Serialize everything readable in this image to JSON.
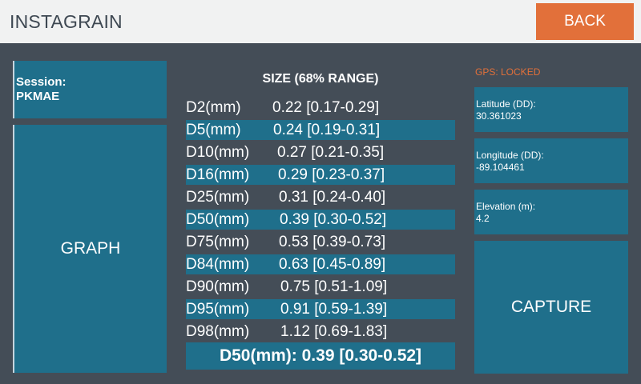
{
  "header": {
    "title": "INSTAGRAIN",
    "back_label": "BACK"
  },
  "session": {
    "label": "Session:",
    "value": "PKMAE"
  },
  "graph_label": "GRAPH",
  "size_table": {
    "title": "SIZE (68% RANGE)",
    "rows": [
      {
        "label": "D2(mm)",
        "value": "0.22 [0.17-0.29]"
      },
      {
        "label": "D5(mm)",
        "value": "0.24 [0.19-0.31]"
      },
      {
        "label": "D10(mm)",
        "value": "0.27 [0.21-0.35]"
      },
      {
        "label": "D16(mm)",
        "value": "0.29 [0.23-0.37]"
      },
      {
        "label": "D25(mm)",
        "value": "0.31 [0.24-0.40]"
      },
      {
        "label": "D50(mm)",
        "value": "0.39 [0.30-0.52]"
      },
      {
        "label": "D75(mm)",
        "value": "0.53 [0.39-0.73]"
      },
      {
        "label": "D84(mm)",
        "value": "0.63 [0.45-0.89]"
      },
      {
        "label": "D90(mm)",
        "value": "0.75 [0.51-1.09]"
      },
      {
        "label": "D95(mm)",
        "value": "0.91 [0.59-1.39]"
      },
      {
        "label": "D98(mm)",
        "value": "1.12 [0.69-1.83]"
      }
    ],
    "summary": "D50(mm): 0.39 [0.30-0.52]"
  },
  "gps": {
    "status": "GPS: LOCKED",
    "latitude_label": "Latitude (DD):",
    "latitude_value": "30.361023",
    "longitude_label": "Longitude (DD):",
    "longitude_value": "-89.104461",
    "elevation_label": "Elevation (m):",
    "elevation_value": "4.2"
  },
  "capture_label": "CAPTURE",
  "colors": {
    "accent": "#e2703a",
    "panel": "#1f6f8b",
    "background": "#444d57",
    "header": "#f1f2f2"
  }
}
